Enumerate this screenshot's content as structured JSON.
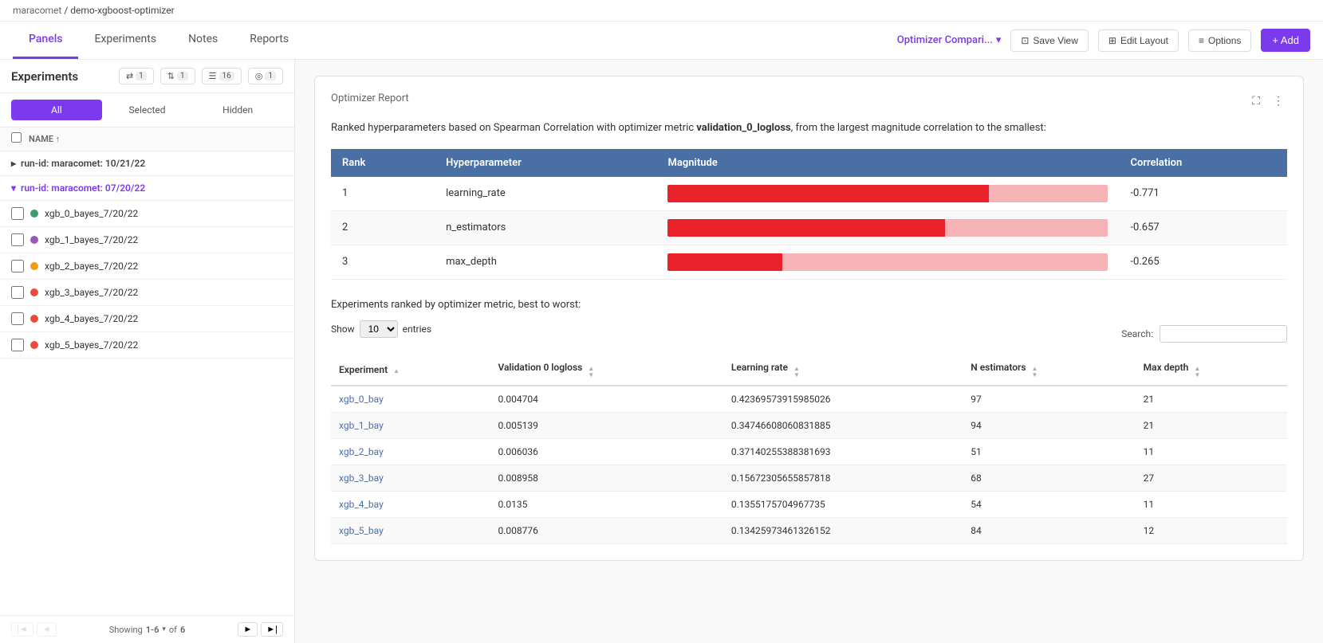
{
  "breadcrumb": {
    "org": "maracomet",
    "separator": "/",
    "project": "demo-xgboost-optimizer"
  },
  "nav": {
    "tabs": [
      {
        "id": "panels",
        "label": "Panels",
        "active": true
      },
      {
        "id": "experiments",
        "label": "Experiments",
        "active": false
      },
      {
        "id": "notes",
        "label": "Notes",
        "active": false
      },
      {
        "id": "reports",
        "label": "Reports",
        "active": false
      }
    ],
    "view_selector_label": "Optimizer Compari...",
    "save_view_label": "Save View",
    "edit_layout_label": "Edit Layout",
    "options_label": "Options",
    "add_label": "+ Add"
  },
  "sidebar": {
    "title": "Experiments",
    "filters": [
      {
        "icon": "sync",
        "count": 1
      },
      {
        "icon": "filter",
        "count": 1
      },
      {
        "icon": "columns",
        "count": 16
      },
      {
        "icon": "eye",
        "count": 1
      }
    ],
    "tabs": [
      "All",
      "Selected",
      "Hidden"
    ],
    "active_tab": "All",
    "col_header": "NAME ↑",
    "groups": [
      {
        "label": "run-id: maracomet: 10/21/22",
        "expanded": false,
        "experiments": []
      },
      {
        "label": "run-id: maracomet: 07/20/22",
        "expanded": true,
        "experiments": [
          {
            "name": "xgb_0_bayes_7/20/22",
            "color": "#3d9970"
          },
          {
            "name": "xgb_1_bayes_7/20/22",
            "color": "#9b59b6"
          },
          {
            "name": "xgb_2_bayes_7/20/22",
            "color": "#f39c12"
          },
          {
            "name": "xgb_3_bayes_7/20/22",
            "color": "#e74c3c"
          },
          {
            "name": "xgb_4_bayes_7/20/22",
            "color": "#e74c3c"
          },
          {
            "name": "xgb_5_bayes_7/20/22",
            "color": "#e74c3c"
          }
        ]
      }
    ],
    "pagination": {
      "showing_text": "Showing",
      "range": "1-6",
      "of_text": "of",
      "total": "6"
    }
  },
  "report": {
    "title": "Optimizer Report",
    "description_prefix": "Ranked hyperparameters based on Spearman Correlation with optimizer metric ",
    "metric_name": "validation_0_logloss",
    "description_suffix": ", from the largest magnitude correlation to the smallest:",
    "corr_table": {
      "headers": [
        "Rank",
        "Hyperparameter",
        "Magnitude",
        "Correlation"
      ],
      "rows": [
        {
          "rank": 1,
          "hyperparameter": "learning_rate",
          "red_pct": 73,
          "pink_pct": 27,
          "correlation": "-0.771"
        },
        {
          "rank": 2,
          "hyperparameter": "n_estimators",
          "red_pct": 63,
          "pink_pct": 37,
          "correlation": "-0.657"
        },
        {
          "rank": 3,
          "hyperparameter": "max_depth",
          "red_pct": 26,
          "pink_pct": 74,
          "correlation": "-0.265"
        }
      ]
    },
    "ranked_section": {
      "title": "Experiments ranked by optimizer metric, best to worst:",
      "show_label": "Show",
      "entries_label": "entries",
      "entries_value": "10",
      "search_label": "Search:",
      "table_headers": [
        {
          "label": "Experiment",
          "sortable": true
        },
        {
          "label": "Validation 0 logloss",
          "sortable": true
        },
        {
          "label": "Learning rate",
          "sortable": true
        },
        {
          "label": "N estimators",
          "sortable": true
        },
        {
          "label": "Max depth",
          "sortable": true
        }
      ],
      "rows": [
        {
          "exp": "xgb_0_bay",
          "validation": "0.004704",
          "learning_rate": "0.42369573915985026",
          "n_estimators": "97",
          "max_depth": "21"
        },
        {
          "exp": "xgb_1_bay",
          "validation": "0.005139",
          "learning_rate": "0.34746608060831885",
          "n_estimators": "94",
          "max_depth": "21"
        },
        {
          "exp": "xgb_2_bay",
          "validation": "0.006036",
          "learning_rate": "0.37140255388381693",
          "n_estimators": "51",
          "max_depth": "11"
        },
        {
          "exp": "xgb_3_bay",
          "validation": "0.008958",
          "learning_rate": "0.15672305655857818",
          "n_estimators": "68",
          "max_depth": "27"
        },
        {
          "exp": "xgb_4_bay",
          "validation": "0.0135",
          "learning_rate": "0.1355175704967735",
          "n_estimators": "54",
          "max_depth": "11"
        },
        {
          "exp": "xgb_5_bay",
          "validation": "0.008776",
          "learning_rate": "0.13425973461326152",
          "n_estimators": "84",
          "max_depth": "12"
        }
      ]
    }
  },
  "icons": {
    "chevron_down": "▾",
    "chevron_right": "▸",
    "chevron_up": "▴",
    "sync": "⇄",
    "filter": "⊟",
    "columns": "☰",
    "eye": "◎",
    "expand": "⛶",
    "menu": "⋮",
    "save": "⊡",
    "layout": "⊞",
    "options": "≡",
    "sort_up": "▲",
    "sort_down": "▼"
  },
  "colors": {
    "accent": "#7c3aed",
    "table_header": "#4a6fa5",
    "bar_red": "#e8212a",
    "bar_pink": "#f5b3b6",
    "link": "#4a6fa5"
  }
}
